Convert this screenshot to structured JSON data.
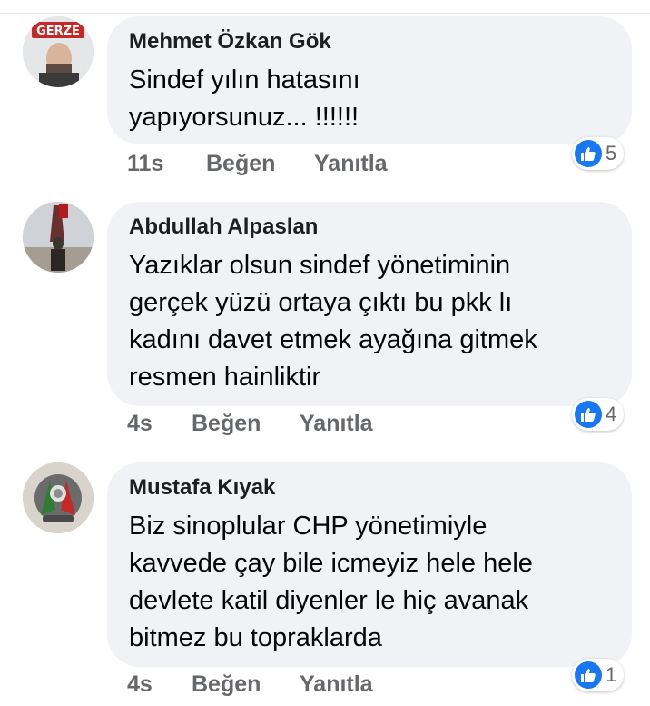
{
  "comments": [
    {
      "author": "Mehmet Özkan Gök",
      "text_lines": [
        "Sindef yılın hatasını",
        "yapıyorsunuz... !!!!!!"
      ],
      "time": "11s",
      "like_label": "Beğen",
      "reply_label": "Yanıtla",
      "reaction_count": "5",
      "avatar_sign_text": "GERZE"
    },
    {
      "author": "Abdullah Alpaslan",
      "text_lines": [
        "Yazıklar olsun sindef yönetiminin",
        "gerçek yüzü ortaya çıktı bu pkk lı",
        "kadını davet etmek ayağına gitmek",
        "resmen hainliktir"
      ],
      "time": "4s",
      "like_label": "Beğen",
      "reply_label": "Yanıtla",
      "reaction_count": "4"
    },
    {
      "author": "Mustafa Kıyak",
      "text_lines": [
        "Biz sinoplular CHP yönetimiyle",
        "kavvede  çay bile icmeyiz hele hele",
        "devlete katil diyenler le hiç avanak",
        "bitmez bu topraklarda"
      ],
      "time": "4s",
      "like_label": "Beğen",
      "reply_label": "Yanıtla",
      "reaction_count": "1"
    }
  ],
  "colors": {
    "bubble": "#f0f2f5",
    "meta_text": "#65676b",
    "like_blue": "#1877f2"
  },
  "icons": {
    "reaction": "like-thumb-icon"
  }
}
